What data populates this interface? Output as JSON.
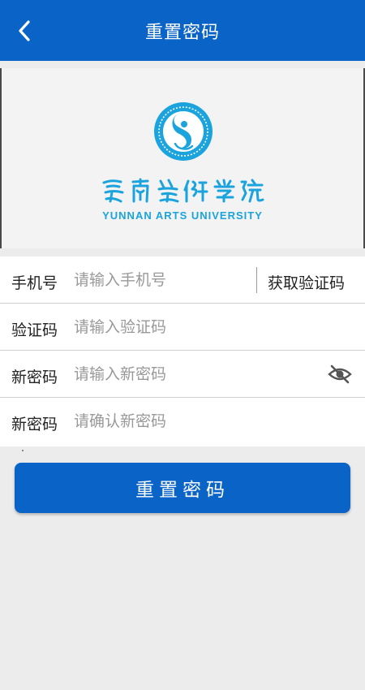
{
  "header": {
    "title": "重置密码",
    "back_icon": "chevron-left-icon"
  },
  "logo": {
    "university_name_en": "YUNNAN ARTS UNIVERSITY",
    "university_name_zh": "雲南藝術學院"
  },
  "form": {
    "phone": {
      "label": "手机号",
      "placeholder": "请输入手机号",
      "value": ""
    },
    "get_code_label": "获取验证码",
    "code": {
      "label": "验证码",
      "placeholder": "请输入验证码",
      "value": ""
    },
    "new_password": {
      "label": "新密码",
      "placeholder": "请输入新密码",
      "value": "",
      "toggle_icon": "eye-off-icon"
    },
    "confirm_password": {
      "label": "新密码",
      "placeholder": "请确认新密码",
      "value": ""
    }
  },
  "submit_label": "重置密码",
  "colors": {
    "primary": "#0a63c7",
    "logo": "#1aa3dd",
    "background": "#ececec"
  }
}
